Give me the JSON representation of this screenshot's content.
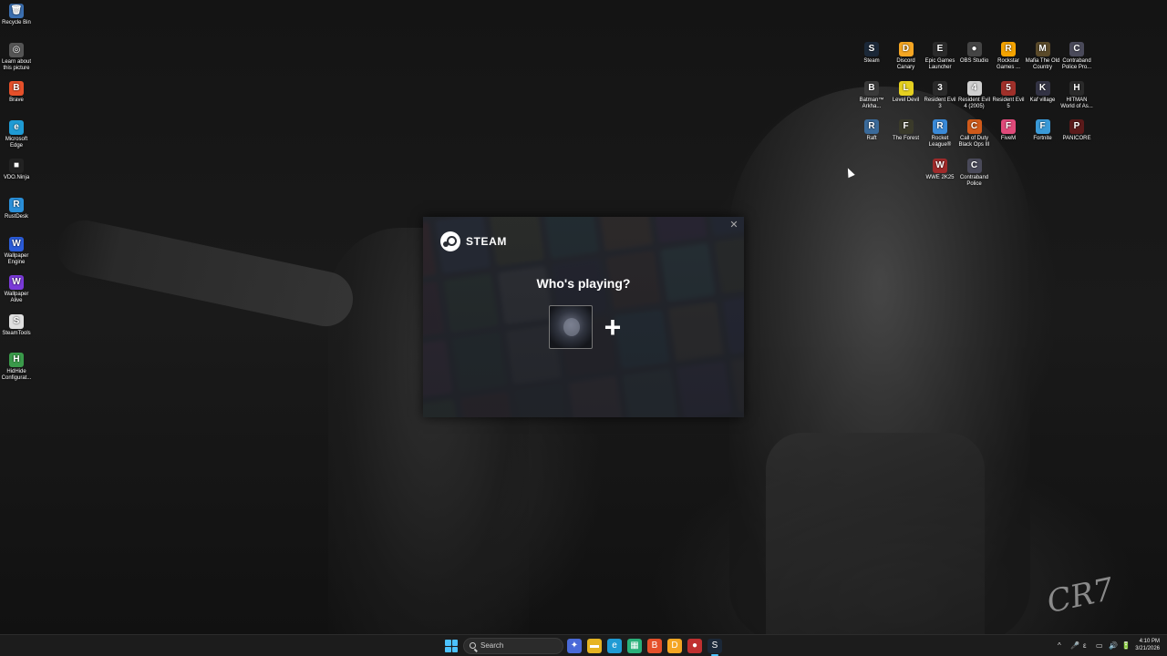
{
  "desktop_left": [
    {
      "label": "Recycle Bin",
      "glyph": "🗑",
      "color": "#3b6fb0"
    },
    {
      "label": "Learn about this picture",
      "glyph": "◎",
      "color": "#555555"
    },
    {
      "label": "Brave",
      "glyph": "B",
      "color": "#e5502a"
    },
    {
      "label": "Microsoft Edge",
      "glyph": "e",
      "color": "#1f9bd4"
    },
    {
      "label": "VDO.Ninja",
      "glyph": "■",
      "color": "#222222"
    },
    {
      "label": "RustDesk",
      "glyph": "R",
      "color": "#2a8fd8"
    },
    {
      "label": "Wallpaper Engine",
      "glyph": "W",
      "color": "#2a5bd8"
    },
    {
      "label": "Wallpaper Alive",
      "glyph": "W",
      "color": "#7a3ad8"
    },
    {
      "label": "SteamTools",
      "glyph": "S",
      "color": "#e0e0e0"
    },
    {
      "label": "HidHide Configurat...",
      "glyph": "H",
      "color": "#3a9a4a"
    }
  ],
  "desktop_right_rows": [
    [
      {
        "label": "Steam",
        "glyph": "S",
        "color": "#1b2838"
      },
      {
        "label": "Discord Canary",
        "glyph": "D",
        "color": "#f5a623"
      },
      {
        "label": "Epic Games Launcher",
        "glyph": "E",
        "color": "#2a2a2a"
      },
      {
        "label": "OBS Studio",
        "glyph": "●",
        "color": "#444444"
      },
      {
        "label": "Rockstar Games ...",
        "glyph": "R",
        "color": "#f4a300"
      },
      {
        "label": "Mafia The Old Country",
        "glyph": "M",
        "color": "#5a4a2a"
      },
      {
        "label": "Contraband Police Pro...",
        "glyph": "C",
        "color": "#4a4a5a"
      }
    ],
    [
      {
        "label": "Batman™ Arkha...",
        "glyph": "B",
        "color": "#3a3a3a"
      },
      {
        "label": "Level Devil",
        "glyph": "L",
        "color": "#e5d020"
      },
      {
        "label": "Resident Evil 3",
        "glyph": "3",
        "color": "#2a2a2a"
      },
      {
        "label": "Resident Evil 4 (2005)",
        "glyph": "4",
        "color": "#d0d0d0"
      },
      {
        "label": "Resident Evil 5",
        "glyph": "5",
        "color": "#a0302a"
      },
      {
        "label": "Kaf village",
        "glyph": "K",
        "color": "#333344"
      },
      {
        "label": "HITMAN World of As...",
        "glyph": "H",
        "color": "#2a2a2a"
      }
    ],
    [
      {
        "label": "Raft",
        "glyph": "R",
        "color": "#3a6a9a"
      },
      {
        "label": "The Forest",
        "glyph": "F",
        "color": "#3a3a2a"
      },
      {
        "label": "Rocket League®",
        "glyph": "R",
        "color": "#3a8ad8"
      },
      {
        "label": "Call of Duty Black Ops III",
        "glyph": "C",
        "color": "#d05a1a"
      },
      {
        "label": "FiveM",
        "glyph": "F",
        "color": "#e04a7a"
      },
      {
        "label": "Fortnite",
        "glyph": "F",
        "color": "#3a9ad8"
      },
      {
        "label": "PANICORE",
        "glyph": "P",
        "color": "#5a1a1a"
      }
    ],
    [
      {
        "label": "WWE 2K25",
        "glyph": "W",
        "color": "#a02a2a"
      },
      {
        "label": "Contraband Police",
        "glyph": "C",
        "color": "#4a4a5a"
      }
    ]
  ],
  "steam": {
    "logo_text": "STEAM",
    "close_glyph": "✕",
    "heading": "Who's playing?",
    "add_glyph": "+"
  },
  "taskbar": {
    "search_label": "Search",
    "time": "4:10 PM",
    "date": "3/21/2026",
    "apps": [
      {
        "name": "copilot-icon",
        "glyph": "✦",
        "color": "#4a6ad8"
      },
      {
        "name": "file-explorer-icon",
        "glyph": "▬",
        "color": "#e6b422"
      },
      {
        "name": "edge-icon",
        "glyph": "e",
        "color": "#1f9bd4"
      },
      {
        "name": "green-app-icon",
        "glyph": "▦",
        "color": "#2ab07a"
      },
      {
        "name": "brave-icon",
        "glyph": "B",
        "color": "#e5502a"
      },
      {
        "name": "discord-canary-icon",
        "glyph": "D",
        "color": "#f5a623"
      },
      {
        "name": "red-app-icon",
        "glyph": "●",
        "color": "#c03030"
      },
      {
        "name": "steam-icon",
        "glyph": "S",
        "color": "#1b2838"
      }
    ],
    "tray_glyphs": [
      "^",
      "🎤",
      "ε",
      "▭",
      "🔊",
      "🔋"
    ]
  }
}
